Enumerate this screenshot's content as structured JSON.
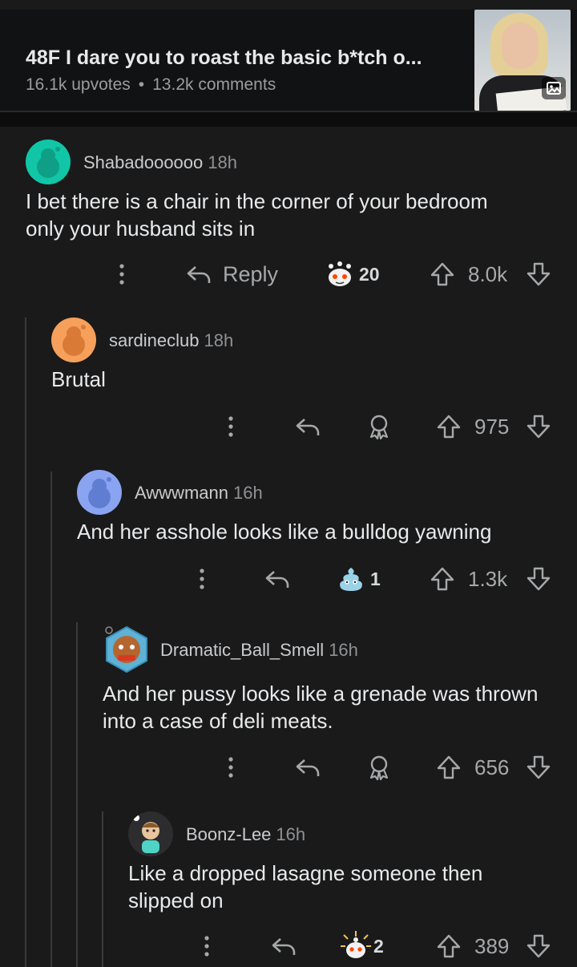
{
  "post": {
    "title": "48F I dare you to roast the basic b*tch o...",
    "upvotes": "16.1k upvotes",
    "separator": "•",
    "comments": "13.2k comments",
    "thumbnail_icon": "image-icon"
  },
  "comments": [
    {
      "username": "Shabadoooooo",
      "age": "18h",
      "text": "I bet there is a chair in the corner of your bedroom only your husband sits in",
      "reply_label": "Reply",
      "award_count": "20",
      "score": "8.0k",
      "avatar_color": "#11c6a6"
    },
    {
      "username": "sardineclub",
      "age": "18h",
      "text": "Brutal",
      "score": "975",
      "avatar_color": "#f6a05c"
    },
    {
      "username": "Awwwmann",
      "age": "16h",
      "text": "And her asshole looks like a bulldog yawning",
      "award_count": "1",
      "score": "1.3k",
      "avatar_color": "#8aa4f2"
    },
    {
      "username": "Dramatic_Ball_Smell",
      "age": "16h",
      "text": "And her pussy looks like a grenade was thrown into a case of deli meats.",
      "score": "656",
      "avatar_color": "#5fb1d6"
    },
    {
      "username": "Boonz-Lee",
      "age": "16h",
      "text": "Like a dropped lasagne someone then slipped on",
      "award_count": "2",
      "score": "389",
      "avatar_color": "#2d2d2f"
    }
  ]
}
